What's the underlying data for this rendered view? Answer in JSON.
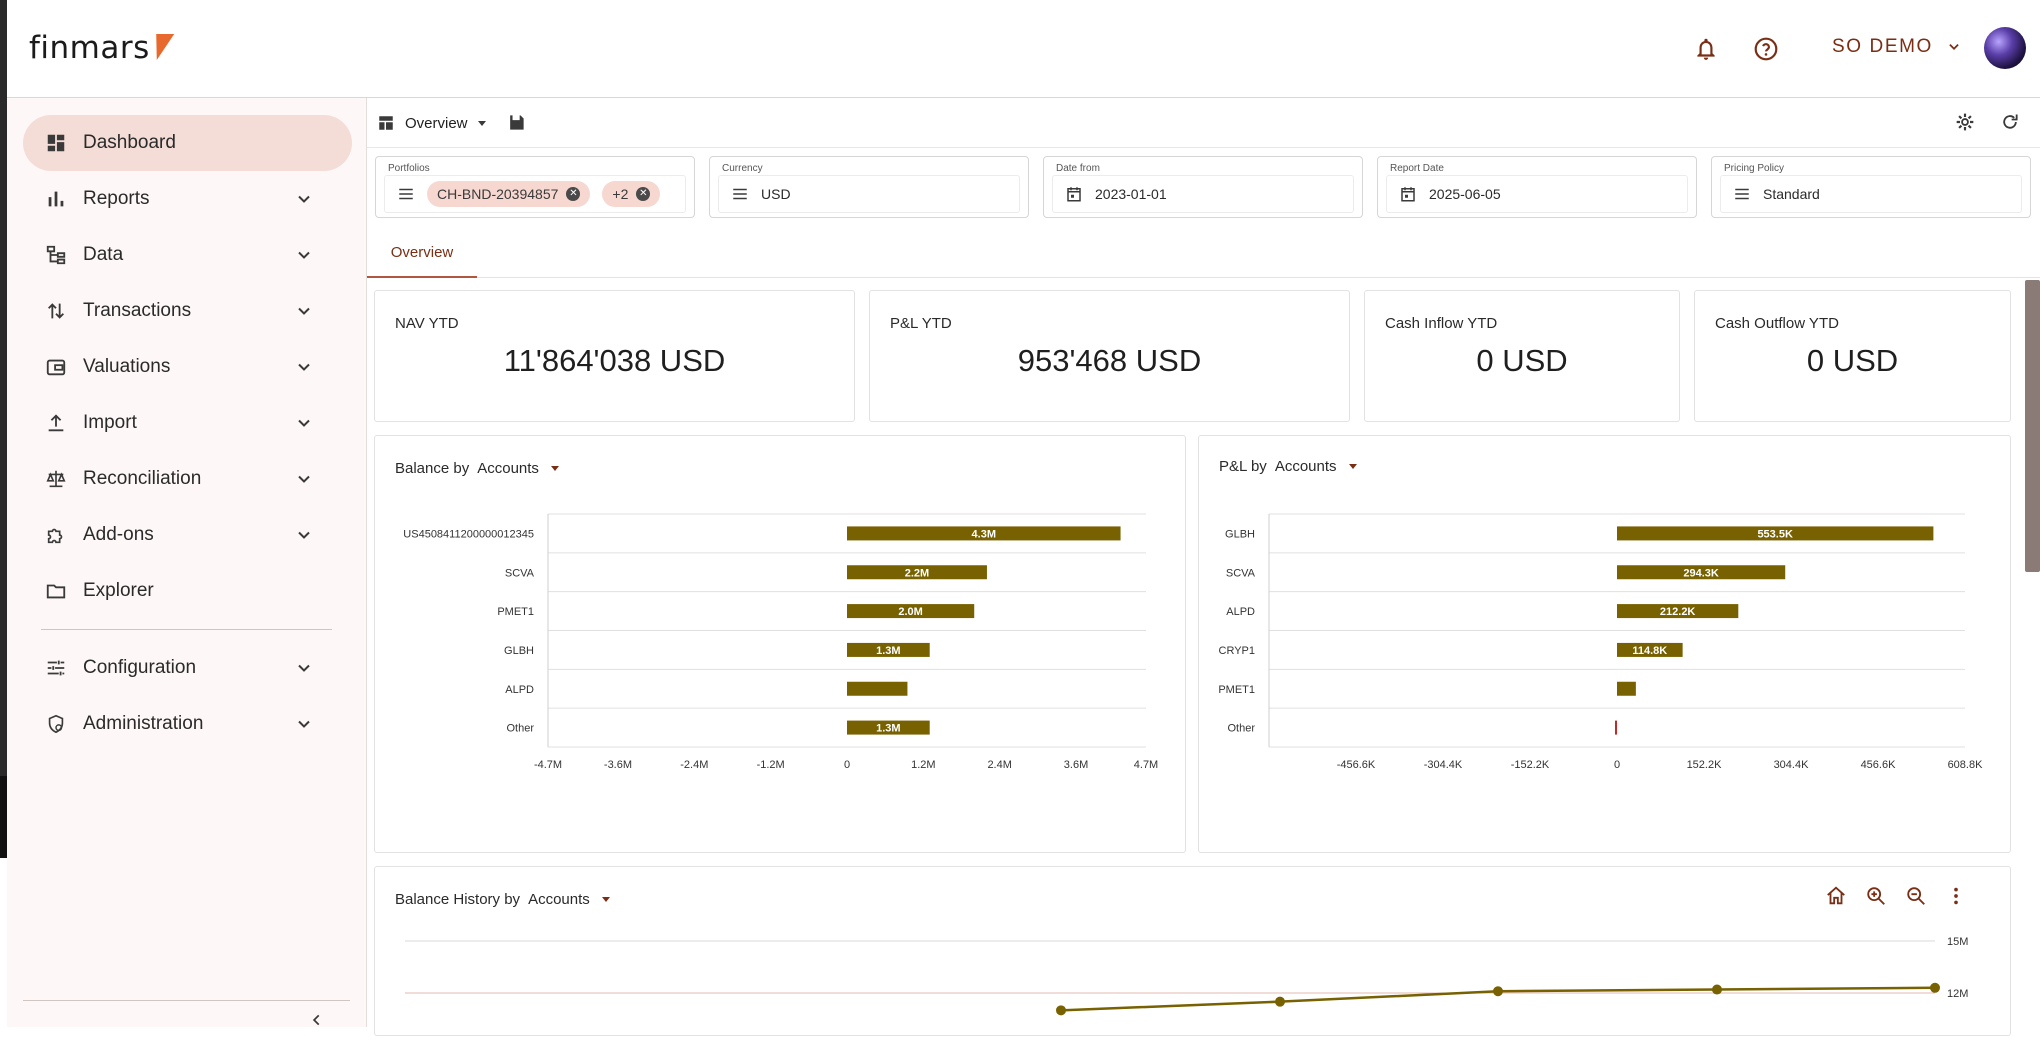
{
  "app": {
    "logo_text": "finmars"
  },
  "header": {
    "user_label": "SO DEMO"
  },
  "sidebar": {
    "items": [
      {
        "label": "Dashboard"
      },
      {
        "label": "Reports"
      },
      {
        "label": "Data"
      },
      {
        "label": "Transactions"
      },
      {
        "label": "Valuations"
      },
      {
        "label": "Import"
      },
      {
        "label": "Reconciliation"
      },
      {
        "label": "Add-ons"
      },
      {
        "label": "Explorer"
      },
      {
        "label": "Configuration"
      },
      {
        "label": "Administration"
      }
    ]
  },
  "toolbar": {
    "layout_label": "Overview"
  },
  "filters": {
    "portfolios": {
      "label": "Portfolios",
      "chip": "CH-BND-20394857",
      "more_chip": "+2"
    },
    "currency": {
      "label": "Currency",
      "value": "USD"
    },
    "date_from": {
      "label": "Date from",
      "value": "2023-01-01"
    },
    "report_date": {
      "label": "Report Date",
      "value": "2025-06-05"
    },
    "pricing_policy": {
      "label": "Pricing Policy",
      "value": "Standard"
    }
  },
  "tabs": [
    {
      "label": "Overview"
    }
  ],
  "kpis": [
    {
      "label": "NAV YTD",
      "value": "11'864'038 USD"
    },
    {
      "label": "P&L YTD",
      "value": "953'468 USD"
    },
    {
      "label": "Cash Inflow YTD",
      "value": "0 USD"
    },
    {
      "label": "Cash Outflow YTD",
      "value": "0 USD"
    }
  ],
  "panels": {
    "balance": {
      "title": "Balance by",
      "selector": "Accounts"
    },
    "pnl": {
      "title": "P&L by",
      "selector": "Accounts"
    },
    "history": {
      "title": "Balance History by",
      "selector": "Accounts"
    }
  },
  "colors": {
    "bar": "#776100",
    "accent": "#7a2e14",
    "negative": "#c62828"
  },
  "chart_data": [
    {
      "type": "bar",
      "orientation": "horizontal",
      "categories": [
        "US4508411200000012345",
        "SCVA",
        "PMET1",
        "GLBH",
        "ALPD",
        "Other"
      ],
      "values": [
        4.3,
        2.2,
        2.0,
        1.3,
        0.95,
        1.3
      ],
      "data_labels": [
        "4.3M",
        "2.2M",
        "2.0M",
        "1.3M",
        "",
        "1.3M"
      ],
      "unit": "M",
      "xlim": [
        -4.7,
        4.7
      ],
      "x_ticks": [
        "-4.7M",
        "-3.6M",
        "-2.4M",
        "-1.2M",
        "0",
        "1.2M",
        "2.4M",
        "3.6M",
        "4.7M"
      ],
      "grid": true
    },
    {
      "type": "bar",
      "orientation": "horizontal",
      "categories": [
        "GLBH",
        "SCVA",
        "ALPD",
        "CRYP1",
        "PMET1",
        "Other"
      ],
      "values": [
        553.5,
        294.3,
        212.2,
        114.8,
        33,
        -2
      ],
      "data_labels": [
        "553.5K",
        "294.3K",
        "212.2K",
        "114.8K",
        "",
        ""
      ],
      "unit": "K",
      "xlim": [
        -608.8,
        608.8
      ],
      "x_ticks": [
        "-456.6K",
        "-304.4K",
        "-152.2K",
        "0",
        "152.2K",
        "304.4K",
        "456.6K",
        "608.8K"
      ],
      "grid": true
    },
    {
      "type": "line",
      "x_index": [
        0,
        1,
        2,
        3,
        4
      ],
      "values": [
        11.0,
        11.5,
        12.1,
        12.2,
        12.3
      ],
      "unit": "M",
      "y_ticks": [
        "15M",
        "12M"
      ],
      "ylim": [
        0,
        15
      ]
    }
  ]
}
